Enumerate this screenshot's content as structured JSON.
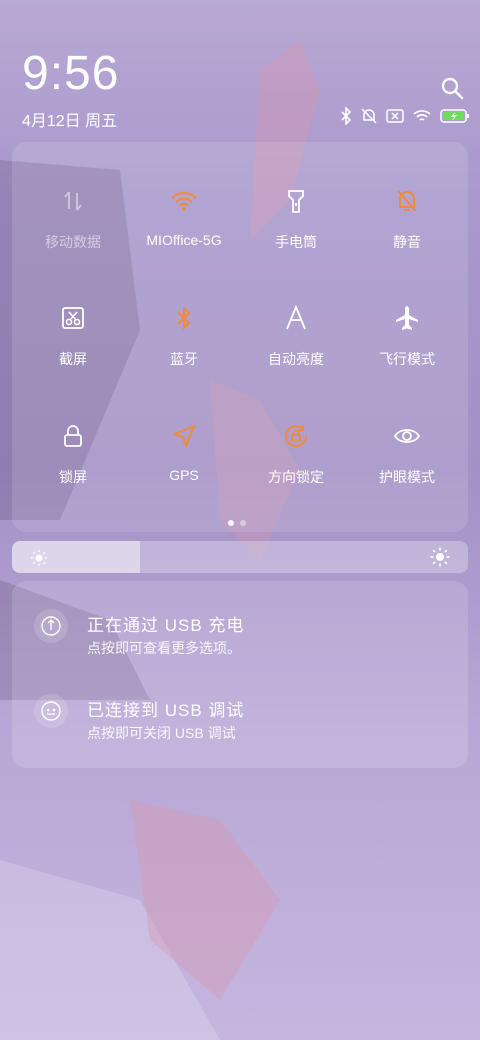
{
  "status_bar": {
    "time": "9:56",
    "date": "4月12日 周五",
    "icons": [
      "bluetooth-icon",
      "mute-bell-icon",
      "no-sim-icon",
      "wifi-icon",
      "battery-charging-icon"
    ]
  },
  "quick_tiles": [
    {
      "label": "移动数据",
      "icon": "mobile-data-icon",
      "active": false
    },
    {
      "label": "MIOffice-5G",
      "icon": "wifi-icon",
      "active": true
    },
    {
      "label": "手电筒",
      "icon": "flashlight-icon",
      "active": false
    },
    {
      "label": "静音",
      "icon": "mute-bell-icon",
      "active": true
    },
    {
      "label": "截屏",
      "icon": "screenshot-icon",
      "active": false
    },
    {
      "label": "蓝牙",
      "icon": "bluetooth-icon",
      "active": true
    },
    {
      "label": "自动亮度",
      "icon": "auto-brightness-icon",
      "active": false
    },
    {
      "label": "飞行模式",
      "icon": "airplane-icon",
      "active": false
    },
    {
      "label": "锁屏",
      "icon": "lock-icon",
      "active": false
    },
    {
      "label": "GPS",
      "icon": "gps-icon",
      "active": true
    },
    {
      "label": "方向锁定",
      "icon": "rotation-lock-icon",
      "active": true
    },
    {
      "label": "护眼模式",
      "icon": "eye-icon",
      "active": false
    }
  ],
  "brightness": {
    "level": 0.28
  },
  "notifications": [
    {
      "title": "正在通过  USB  充电",
      "subtitle": "点按即可查看更多选项。"
    },
    {
      "title": "已连接到  USB  调试",
      "subtitle": "点按即可关闭 USB 调试"
    }
  ],
  "colors": {
    "accent": "#f08a3c",
    "text": "#ffffff"
  }
}
